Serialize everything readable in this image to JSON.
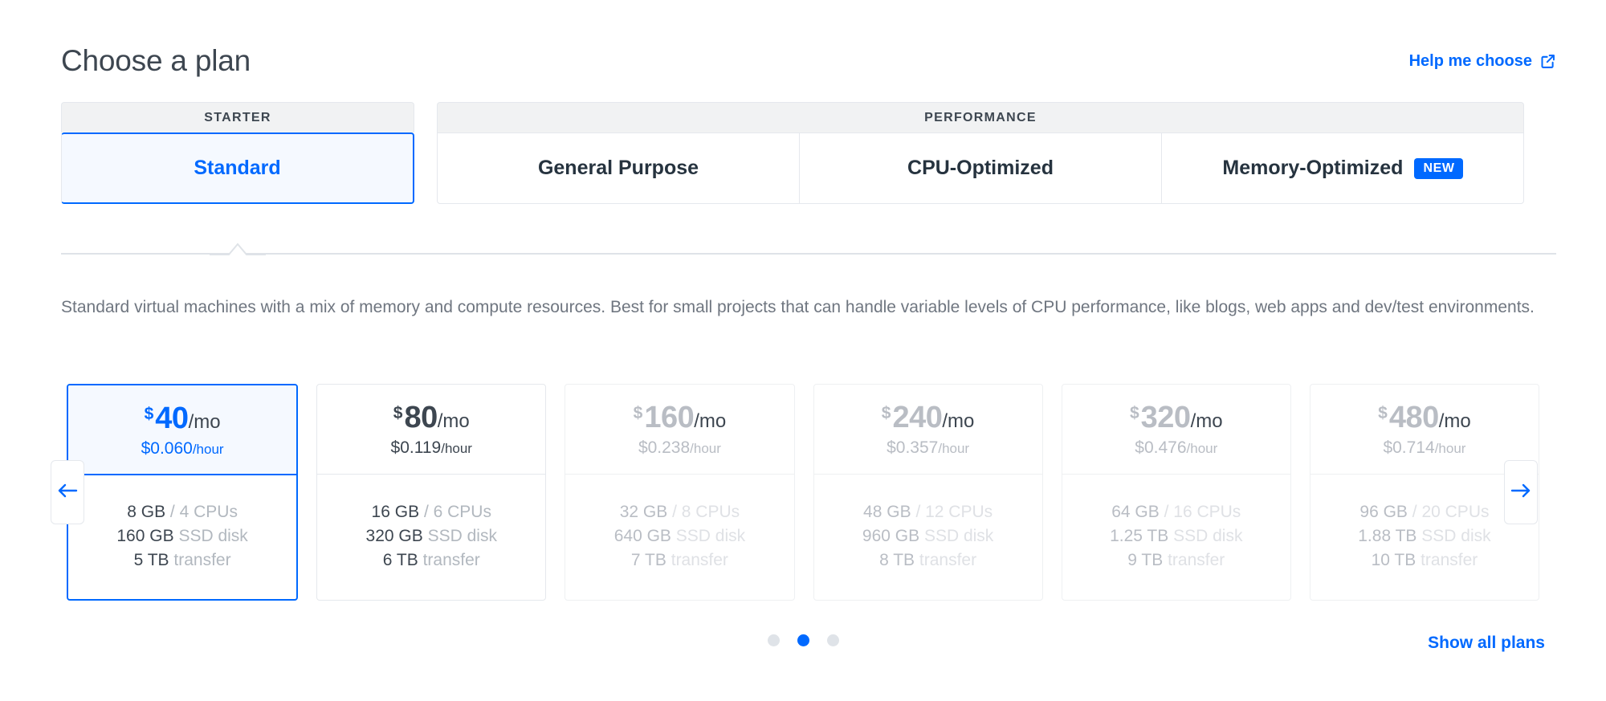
{
  "header": {
    "title": "Choose a plan",
    "help_link": "Help me choose",
    "help_icon": "external-link-icon"
  },
  "categories": {
    "starter_label": "STARTER",
    "performance_label": "PERFORMANCE"
  },
  "tabs": [
    {
      "label": "Standard",
      "category": "STARTER",
      "selected": true,
      "badge": ""
    },
    {
      "label": "General Purpose",
      "category": "PERFORMANCE",
      "selected": false,
      "badge": ""
    },
    {
      "label": "CPU-Optimized",
      "category": "PERFORMANCE",
      "selected": false,
      "badge": ""
    },
    {
      "label": "Memory-Optimized",
      "category": "PERFORMANCE",
      "selected": false,
      "badge": "NEW"
    }
  ],
  "description": "Standard virtual machines with a mix of memory and compute resources. Best for small projects that can handle variable levels of CPU performance, like blogs, web apps and dev/test environments.",
  "plans": [
    {
      "currency": "$",
      "monthly": "40",
      "per": "/mo",
      "hourly_amount": "$0.060",
      "hourly_unit": "/hour",
      "memory": "8 GB",
      "cpus": "/ 4 CPUs",
      "disk_amount": "160 GB",
      "disk_label": "SSD disk",
      "transfer_amount": "5 TB",
      "transfer_label": "transfer",
      "selected": true,
      "dim": false
    },
    {
      "currency": "$",
      "monthly": "80",
      "per": "/mo",
      "hourly_amount": "$0.119",
      "hourly_unit": "/hour",
      "memory": "16 GB",
      "cpus": "/ 6 CPUs",
      "disk_amount": "320 GB",
      "disk_label": "SSD disk",
      "transfer_amount": "6 TB",
      "transfer_label": "transfer",
      "selected": false,
      "dim": false
    },
    {
      "currency": "$",
      "monthly": "160",
      "per": "/mo",
      "hourly_amount": "$0.238",
      "hourly_unit": "/hour",
      "memory": "32 GB",
      "cpus": "/ 8 CPUs",
      "disk_amount": "640 GB",
      "disk_label": "SSD disk",
      "transfer_amount": "7 TB",
      "transfer_label": "transfer",
      "selected": false,
      "dim": true
    },
    {
      "currency": "$",
      "monthly": "240",
      "per": "/mo",
      "hourly_amount": "$0.357",
      "hourly_unit": "/hour",
      "memory": "48 GB",
      "cpus": "/ 12 CPUs",
      "disk_amount": "960 GB",
      "disk_label": "SSD disk",
      "transfer_amount": "8 TB",
      "transfer_label": "transfer",
      "selected": false,
      "dim": true
    },
    {
      "currency": "$",
      "monthly": "320",
      "per": "/mo",
      "hourly_amount": "$0.476",
      "hourly_unit": "/hour",
      "memory": "64 GB",
      "cpus": "/ 16 CPUs",
      "disk_amount": "1.25 TB",
      "disk_label": "SSD disk",
      "transfer_amount": "9 TB",
      "transfer_label": "transfer",
      "selected": false,
      "dim": true
    },
    {
      "currency": "$",
      "monthly": "480",
      "per": "/mo",
      "hourly_amount": "$0.714",
      "hourly_unit": "/hour",
      "memory": "96 GB",
      "cpus": "/ 20 CPUs",
      "disk_amount": "1.88 TB",
      "disk_label": "SSD disk",
      "transfer_amount": "10 TB",
      "transfer_label": "transfer",
      "selected": false,
      "dim": true
    }
  ],
  "carousel": {
    "prev_icon": "arrow-left-icon",
    "next_icon": "arrow-right-icon",
    "dots": 3,
    "active_dot": 1
  },
  "footer": {
    "show_all_label": "Show all plans"
  },
  "colors": {
    "accent": "#0069ff",
    "text": "#3d4650",
    "muted": "#b2b8bf",
    "border": "#e5e8ed",
    "selected_bg": "#f5f9ff",
    "category_bg": "#f1f2f3"
  }
}
